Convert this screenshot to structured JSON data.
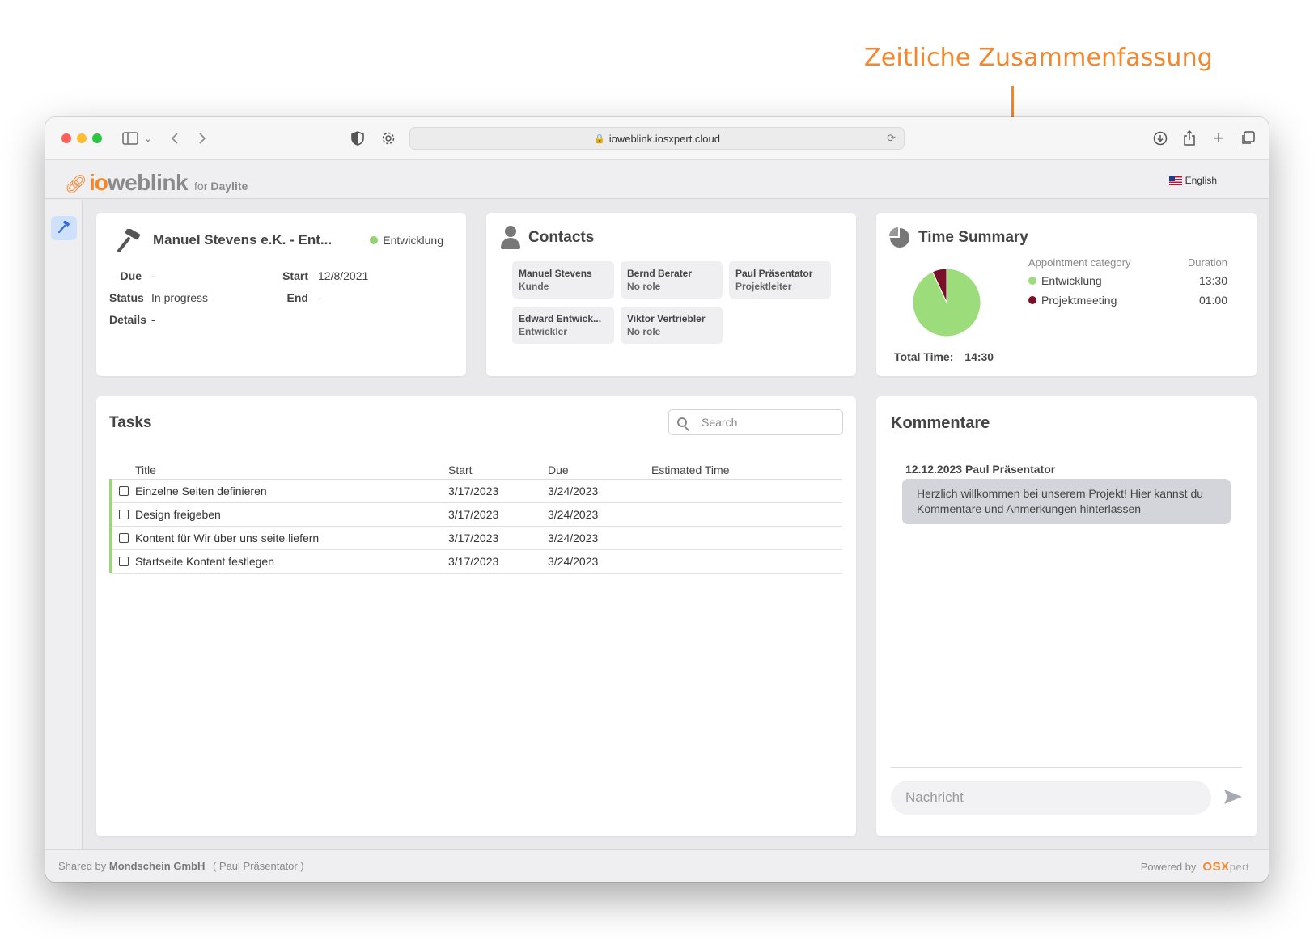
{
  "annotation": {
    "text": "Zeitliche Zusammenfassung"
  },
  "browser": {
    "url": "ioweblink.iosxpert.cloud"
  },
  "app": {
    "brand_io": "io",
    "brand_web": "weblink",
    "for_text": "for",
    "for_product": "Daylite",
    "language": "English"
  },
  "project": {
    "title": "Manuel Stevens e.K. - Ent...",
    "category": "Entwicklung",
    "category_color": "#8fd470",
    "fields": {
      "due_label": "Due",
      "due_value": "-",
      "status_label": "Status",
      "status_value": "In progress",
      "details_label": "Details",
      "details_value": "-",
      "start_label": "Start",
      "start_value": "12/8/2021",
      "end_label": "End",
      "end_value": "-"
    }
  },
  "contacts": {
    "title": "Contacts",
    "items": [
      {
        "name": "Manuel Stevens",
        "role": "Kunde"
      },
      {
        "name": "Bernd Berater",
        "role": "No role"
      },
      {
        "name": "Paul Präsentator",
        "role": "Projektleiter"
      },
      {
        "name": "Edward Entwick...",
        "role": "Entwickler"
      },
      {
        "name": "Viktor Vertriebler",
        "role": "No role"
      }
    ]
  },
  "time_summary": {
    "title": "Time Summary",
    "col_category": "Appointment category",
    "col_duration": "Duration",
    "rows": [
      {
        "category": "Entwicklung",
        "duration": "13:30",
        "color": "#9cdc7a"
      },
      {
        "category": "Projektmeeting",
        "duration": "01:00",
        "color": "#7a0f2a"
      }
    ],
    "total_label": "Total Time:",
    "total_value": "14:30",
    "pie_minutes": [
      810,
      60
    ]
  },
  "tasks": {
    "title": "Tasks",
    "search_placeholder": "Search",
    "columns": [
      "Title",
      "Start",
      "Due",
      "Estimated Time"
    ],
    "rows": [
      {
        "title": "Einzelne Seiten definieren",
        "start": "3/17/2023",
        "due": "3/24/2023",
        "estimated": ""
      },
      {
        "title": "Design freigeben",
        "start": "3/17/2023",
        "due": "3/24/2023",
        "estimated": ""
      },
      {
        "title": "Kontent für Wir über uns seite liefern",
        "start": "3/17/2023",
        "due": "3/24/2023",
        "estimated": ""
      },
      {
        "title": "Startseite Kontent festlegen",
        "start": "3/17/2023",
        "due": "3/24/2023",
        "estimated": ""
      }
    ]
  },
  "comments": {
    "title": "Kommentare",
    "items": [
      {
        "meta": "12.12.2023 Paul Präsentator",
        "text": "Herzlich willkommen bei unserem Projekt! Hier kannst du Kommentare und Anmerkungen hinterlassen"
      }
    ],
    "input_placeholder": "Nachricht"
  },
  "footer": {
    "shared_by": "Shared by",
    "company": "Mondschein GmbH",
    "user": "( Paul Präsentator )",
    "powered_by": "Powered by",
    "powered_brand": "OSX",
    "powered_brand_rest": "pert"
  },
  "colors": {
    "accent": "#f5862a",
    "active_nav": "#cfe0fb"
  }
}
